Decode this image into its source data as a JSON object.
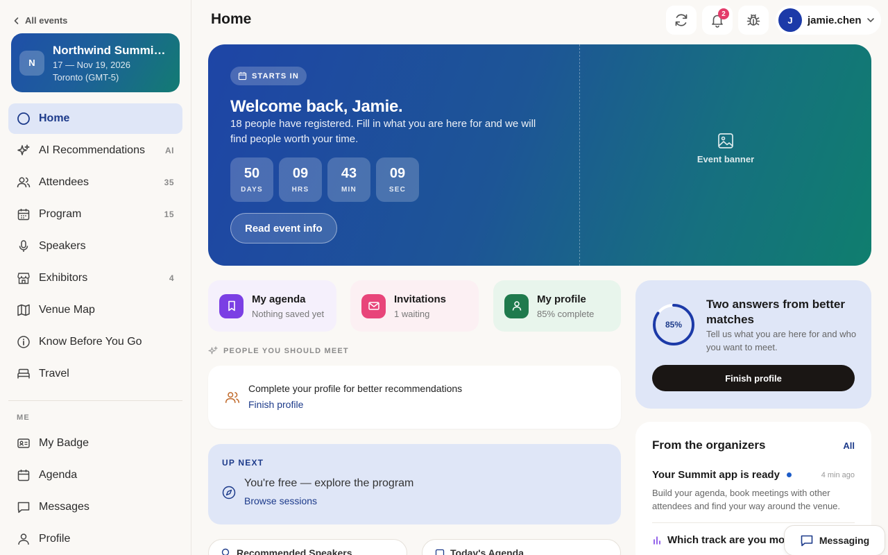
{
  "sidebar": {
    "back_label": "All events",
    "event": {
      "initial": "N",
      "name": "Northwind Summit ...",
      "dates": "17 — Nov 19, 2026",
      "timezone": "Toronto (GMT-5)"
    },
    "nav": [
      {
        "label": "Home",
        "count": "",
        "icon": "circle-icon",
        "active": true
      },
      {
        "label": "AI Recommendations",
        "count": "AI",
        "icon": "sparkles-icon"
      },
      {
        "label": "Attendees",
        "count": "35",
        "icon": "users-icon"
      },
      {
        "label": "Program",
        "count": "15",
        "icon": "calendar-grid-icon"
      },
      {
        "label": "Speakers",
        "count": "",
        "icon": "microphone-icon"
      },
      {
        "label": "Exhibitors",
        "count": "4",
        "icon": "store-icon"
      },
      {
        "label": "Venue Map",
        "count": "",
        "icon": "map-icon"
      },
      {
        "label": "Know Before You Go",
        "count": "",
        "icon": "info-icon"
      },
      {
        "label": "Travel",
        "count": "",
        "icon": "bed-icon"
      }
    ],
    "me_section": "ME",
    "me_nav": [
      {
        "label": "My Badge",
        "icon": "badge-icon"
      },
      {
        "label": "Agenda",
        "icon": "calendar-icon"
      },
      {
        "label": "Messages",
        "icon": "message-icon"
      },
      {
        "label": "Profile",
        "icon": "user-icon"
      }
    ]
  },
  "header": {
    "title": "Home",
    "notification_count": "2",
    "user_initial": "J",
    "user_name": "jamie.chen"
  },
  "hero": {
    "pill": "STARTS IN",
    "title": "Welcome back, Jamie.",
    "subtitle": "18 people have registered. Fill in what you are here for and we will find people worth your time.",
    "countdown": [
      {
        "value": "50",
        "label": "DAYS"
      },
      {
        "value": "09",
        "label": "HRS"
      },
      {
        "value": "43",
        "label": "MIN"
      },
      {
        "value": "09",
        "label": "SEC"
      }
    ],
    "button": "Read event info",
    "banner_label": "Event banner"
  },
  "quick_actions": [
    {
      "title": "My agenda",
      "subtitle": "Nothing saved yet",
      "color": "#7b3fe4",
      "bg": "#f5f0fc"
    },
    {
      "title": "Invitations",
      "subtitle": "1 waiting",
      "color": "#e8457a",
      "bg": "#fcf0f3"
    },
    {
      "title": "My profile",
      "subtitle": "85% complete",
      "color": "#1f7a4d",
      "bg": "#e8f5ec"
    }
  ],
  "people": {
    "section_label": "PEOPLE YOU SHOULD MEET",
    "title": "Complete your profile for better recommendations",
    "link": "Finish profile"
  },
  "up_next": {
    "label": "UP NEXT",
    "title": "You're free — explore the program",
    "link": "Browse sessions"
  },
  "bottom_pills": [
    {
      "label": "Recommended Speakers"
    },
    {
      "label": "Today's Agenda"
    }
  ],
  "profile_card": {
    "percent_label": "85%",
    "progress": 0.85,
    "title": "Two answers from better matches",
    "subtitle": "Tell us what you are here for and who you want to meet.",
    "button": "Finish profile"
  },
  "organizers": {
    "title": "From the organizers",
    "all_link": "All",
    "news": [
      {
        "title": "Your Summit app is ready",
        "time": "4 min ago",
        "body": "Build your agenda, book meetings with other attendees and find your way around the venue."
      },
      {
        "title": "Which track are you mo"
      }
    ]
  },
  "messaging_label": "Messaging",
  "colors": {
    "accent": "#1c3a8a",
    "active_bg": "#dfe6f7",
    "badge": "#e33c6a"
  }
}
